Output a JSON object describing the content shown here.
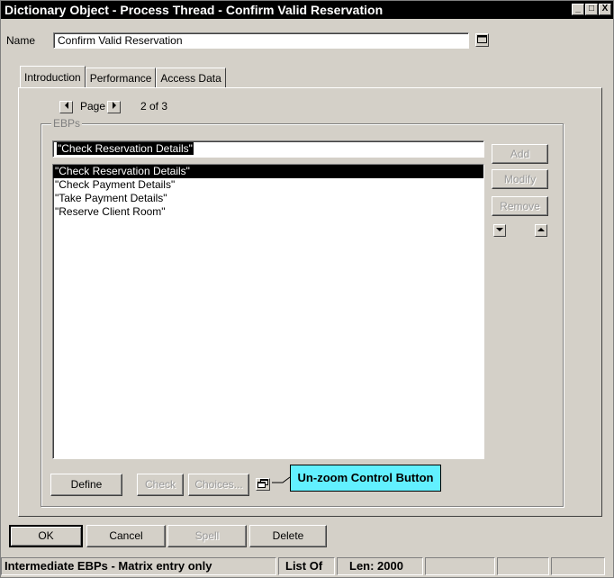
{
  "window": {
    "title": "Dictionary Object - Process Thread - Confirm Valid Reservation",
    "controls": {
      "minimize": "_",
      "maximize": "□",
      "close": "X"
    }
  },
  "name_field": {
    "label": "Name",
    "value": "Confirm Valid Reservation"
  },
  "tabs": [
    {
      "label": "Introduction",
      "active": true
    },
    {
      "label": "Performance",
      "active": false
    },
    {
      "label": "Access Data",
      "active": false
    }
  ],
  "pager": {
    "label": "Page",
    "position": "2 of 3"
  },
  "ebps": {
    "group_label": "EBPs",
    "current_value": "\"Check Reservation Details\"",
    "items": [
      "\"Check Reservation Details\"",
      "\"Check Payment Details\"",
      "\"Take Payment Details\"",
      "\"Reserve Client Room\""
    ],
    "selected_index": 0
  },
  "side_buttons": {
    "add": "Add",
    "modify": "Modify",
    "remove": "Remove"
  },
  "bottom_buttons": {
    "define": "Define",
    "check": "Check",
    "choices": "Choices..."
  },
  "callout": {
    "text": "Un-zoom Control Button",
    "color": "#62f0ff"
  },
  "dialog_buttons": {
    "ok": "OK",
    "cancel": "Cancel",
    "spell": "Spell",
    "delete": "Delete"
  },
  "status_bar": {
    "message": "Intermediate EBPs - Matrix entry only",
    "type": "List Of",
    "length": "Len: 2000"
  }
}
